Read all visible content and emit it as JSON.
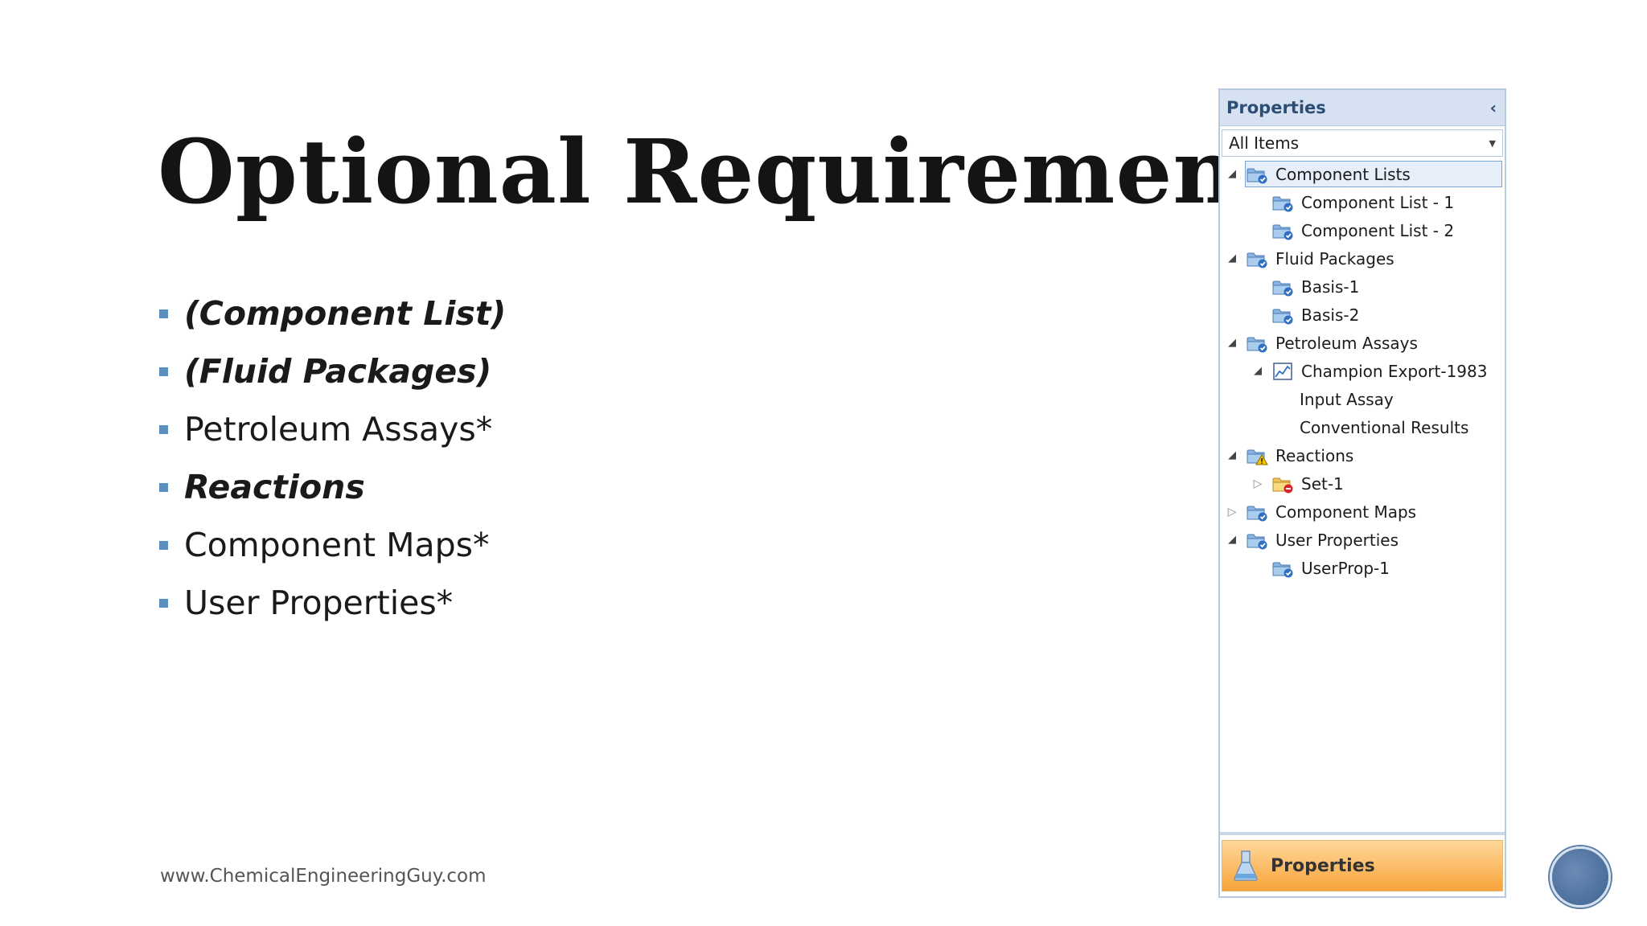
{
  "slide": {
    "title": "Optional Requirements",
    "bullets": [
      {
        "label": "(Component List)",
        "style": "bold-italic"
      },
      {
        "label": "(Fluid Packages)",
        "style": "bold-italic"
      },
      {
        "label": "Petroleum Assays*",
        "style": "normal"
      },
      {
        "label": "Reactions",
        "style": "bold-italic"
      },
      {
        "label": "Component Maps*",
        "style": "normal"
      },
      {
        "label": "User Properties*",
        "style": "normal"
      }
    ],
    "footer_url": "www.ChemicalEngineeringGuy.com",
    "bullet_color": "#5b8fc0"
  },
  "panel": {
    "title": "Properties",
    "filter_value": "All Items",
    "tree": [
      {
        "label": "Component Lists",
        "icon": "folder-check-icon",
        "expander": "expanded",
        "selected": true
      },
      {
        "label": "Component List - 1",
        "icon": "folder-check-icon",
        "expander": "none"
      },
      {
        "label": "Component List - 2",
        "icon": "folder-check-icon",
        "expander": "none"
      },
      {
        "label": "Fluid Packages",
        "icon": "folder-check-icon",
        "expander": "expanded"
      },
      {
        "label": "Basis-1",
        "icon": "folder-check-icon",
        "expander": "none"
      },
      {
        "label": "Basis-2",
        "icon": "folder-check-icon",
        "expander": "none"
      },
      {
        "label": "Petroleum Assays",
        "icon": "folder-check-icon",
        "expander": "expanded"
      },
      {
        "label": "Champion Export-1983",
        "icon": "chart-line-icon",
        "expander": "expanded"
      },
      {
        "label": "Input Assay",
        "icon": "",
        "expander": "none"
      },
      {
        "label": "Conventional Results",
        "icon": "",
        "expander": "none"
      },
      {
        "label": "Reactions",
        "icon": "folder-warning-icon",
        "expander": "expanded"
      },
      {
        "label": "Set-1",
        "icon": "folder-error-icon",
        "expander": "collapsed"
      },
      {
        "label": "Component Maps",
        "icon": "folder-check-icon",
        "expander": "collapsed"
      },
      {
        "label": "User Properties",
        "icon": "folder-check-icon",
        "expander": "expanded"
      },
      {
        "label": "UserProp-1",
        "icon": "folder-check-icon",
        "expander": "none"
      }
    ],
    "footer_tab_label": "Properties",
    "footer_tab_color": "#f7a33a",
    "header_color": "#d6e2f1"
  }
}
